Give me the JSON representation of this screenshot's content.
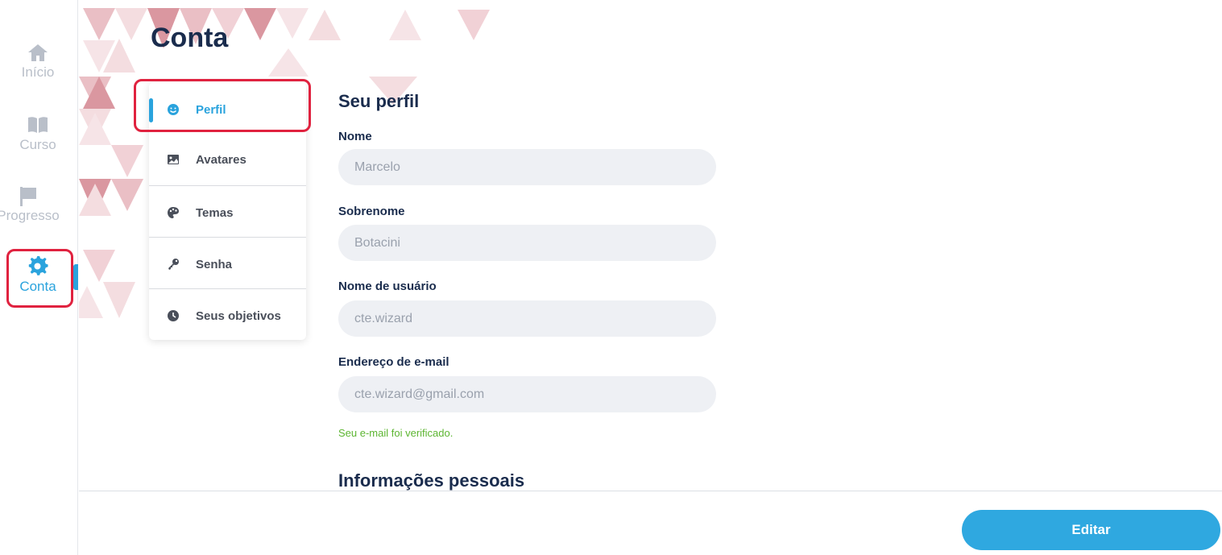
{
  "nav": {
    "items": [
      {
        "label": "Início",
        "icon": "home-icon"
      },
      {
        "label": "Curso",
        "icon": "book-icon"
      },
      {
        "label": "Progresso",
        "icon": "flag-icon"
      },
      {
        "label": "Conta",
        "icon": "gear-icon"
      }
    ],
    "active_item": "Conta"
  },
  "page": {
    "title": "Conta"
  },
  "account_menu": {
    "items": [
      {
        "label": "Perfil",
        "icon": "smiley-icon"
      },
      {
        "label": "Avatares",
        "icon": "image-icon"
      },
      {
        "label": "Temas",
        "icon": "palette-icon"
      },
      {
        "label": "Senha",
        "icon": "key-icon"
      },
      {
        "label": "Seus objetivos",
        "icon": "clock-icon"
      }
    ],
    "active_item": "Perfil"
  },
  "profile": {
    "title": "Seu perfil",
    "fields": [
      {
        "label": "Nome",
        "value": "Marcelo"
      },
      {
        "label": "Sobrenome",
        "value": "Botacini"
      },
      {
        "label": "Nome de usuário",
        "value": "cte.wizard"
      },
      {
        "label": "Endereço de e-mail",
        "value": "cte.wizard@gmail.com"
      }
    ],
    "email_status": "Seu e-mail foi verificado.",
    "next_section_title": "Informações pessoais"
  },
  "actions": {
    "edit_label": "Editar"
  },
  "colors": {
    "accent": "#2aa3dd",
    "highlight": "#e0223f",
    "success": "#5cb531",
    "heading": "#1a2c4d"
  }
}
